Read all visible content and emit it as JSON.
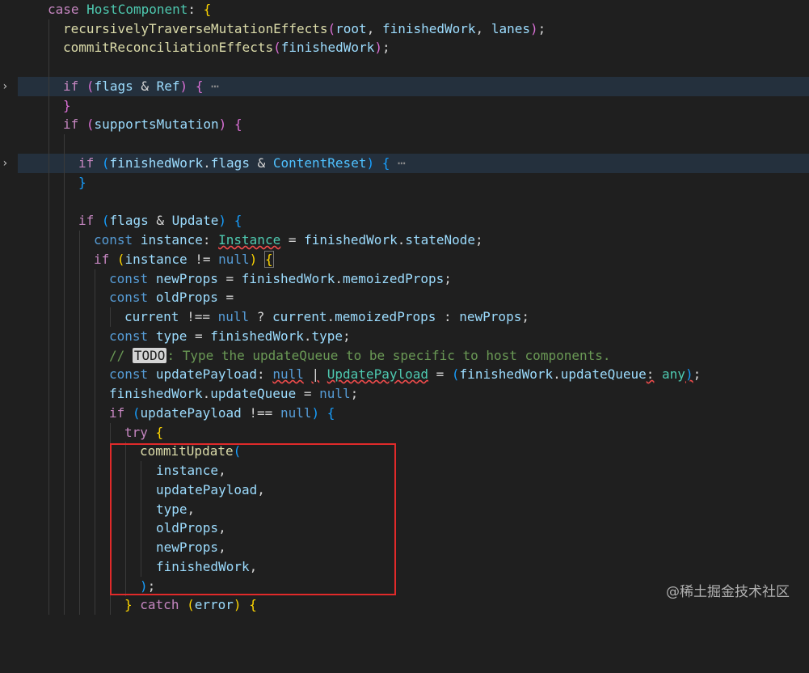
{
  "lines": [
    "case HostComponent: {",
    "recursivelyTraverseMutationEffects(root, finishedWork, lanes);",
    "commitReconciliationEffects(finishedWork);",
    "if (flags & Ref) {",
    "}",
    "if (supportsMutation) {",
    "if (finishedWork.flags & ContentReset) {",
    "}",
    "if (flags & Update) {",
    "const instance: Instance = finishedWork.stateNode;",
    "if (instance != null) {",
    "const newProps = finishedWork.memoizedProps;",
    "const oldProps =",
    "current !== null ? current.memoizedProps : newProps;",
    "const type = finishedWork.type;",
    "// TODO: Type the updateQueue to be specific to host components.",
    "const updatePayload: null | UpdatePayload = (finishedWork.updateQueue: any);",
    "finishedWork.updateQueue = null;",
    "if (updatePayload !== null) {",
    "try {",
    "commitUpdate(",
    "instance,",
    "updatePayload,",
    "type,",
    "oldProps,",
    "newProps,",
    "finishedWork,",
    ");",
    "} catch (error) {"
  ],
  "folded_marker": "⋯",
  "watermark": "@稀土掘金技术社区",
  "colors": {
    "background": "#1f1f1f",
    "keyword": "#569cd6",
    "control": "#c586c0",
    "function": "#dcdcaa",
    "variable": "#9cdcfe",
    "type": "#4ec9b0",
    "comment": "#6a9955",
    "highlight_box": "#e02a2a"
  }
}
